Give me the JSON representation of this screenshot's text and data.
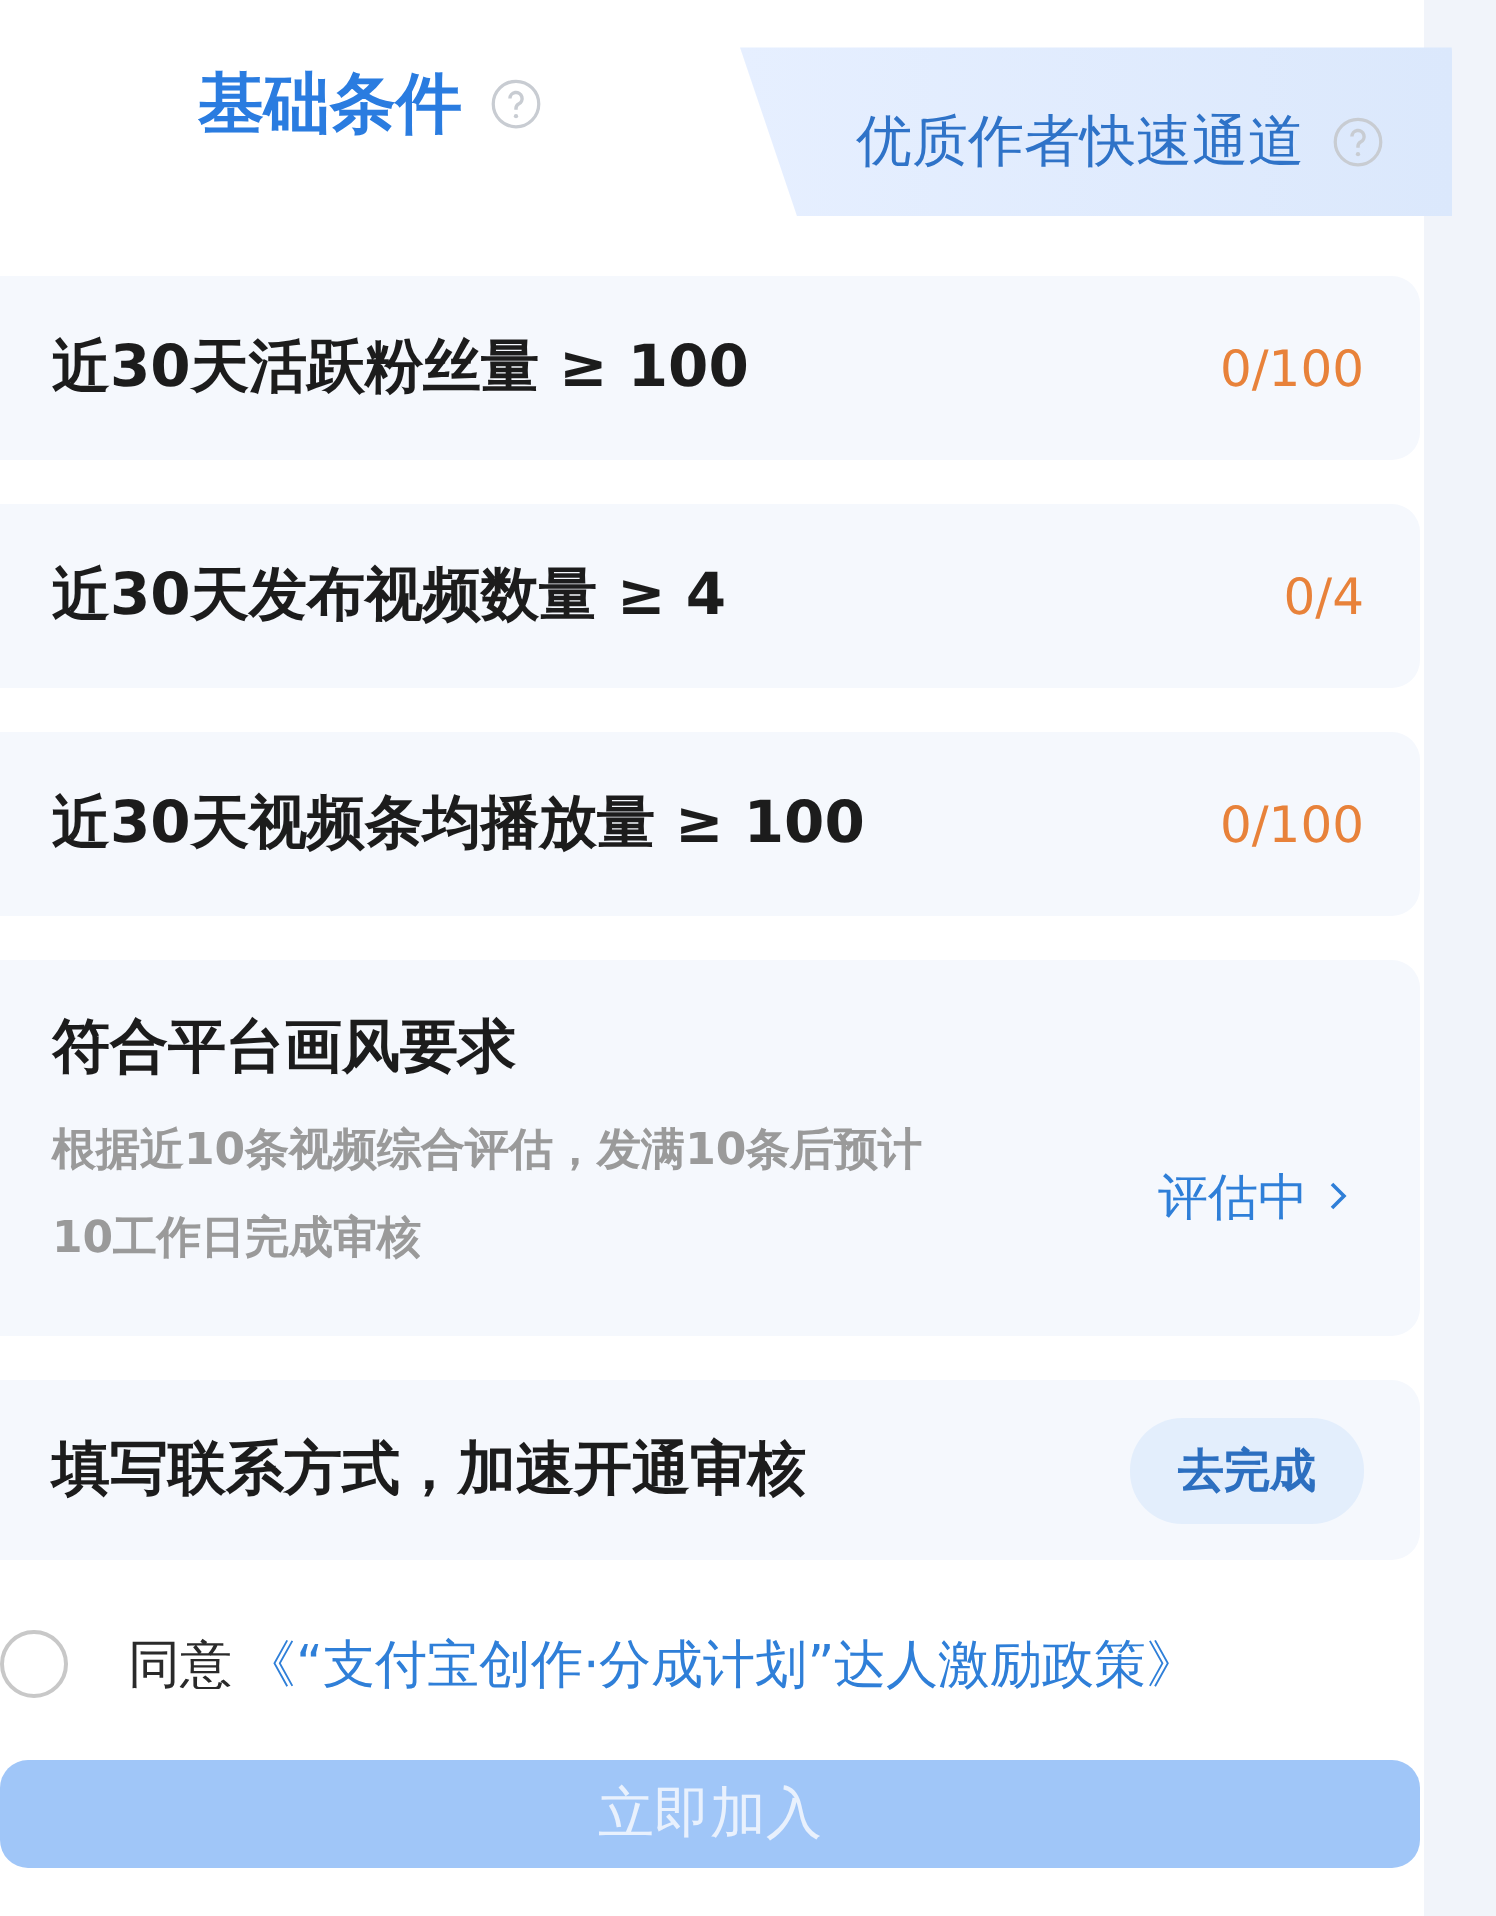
{
  "tabs": [
    {
      "label": "基础条件",
      "selected": true
    },
    {
      "label": "优质作者快速通道",
      "selected": false
    }
  ],
  "conditions": [
    {
      "kind": "progress",
      "label": "近30天活跃粉丝量 ≥ 100",
      "value": "0/100"
    },
    {
      "kind": "progress",
      "label": "近30天发布视频数量 ≥ 4",
      "value": "0/4"
    },
    {
      "kind": "progress",
      "label": "近30天视频条均播放量 ≥ 100",
      "value": "0/100"
    },
    {
      "kind": "review",
      "label": "符合平台画风要求",
      "description": "根据近10条视频综合评估，发满10条后预计10工作日完成审核",
      "status": "评估中"
    },
    {
      "kind": "action",
      "label": "填写联系方式，加速开通审核",
      "button": "去完成"
    }
  ],
  "agreement": {
    "checked": false,
    "prefix": "同意",
    "link": "《“支付宝创作·分成计划”达人激励政策》"
  },
  "join_button": {
    "label": "立即加入",
    "disabled": true
  }
}
